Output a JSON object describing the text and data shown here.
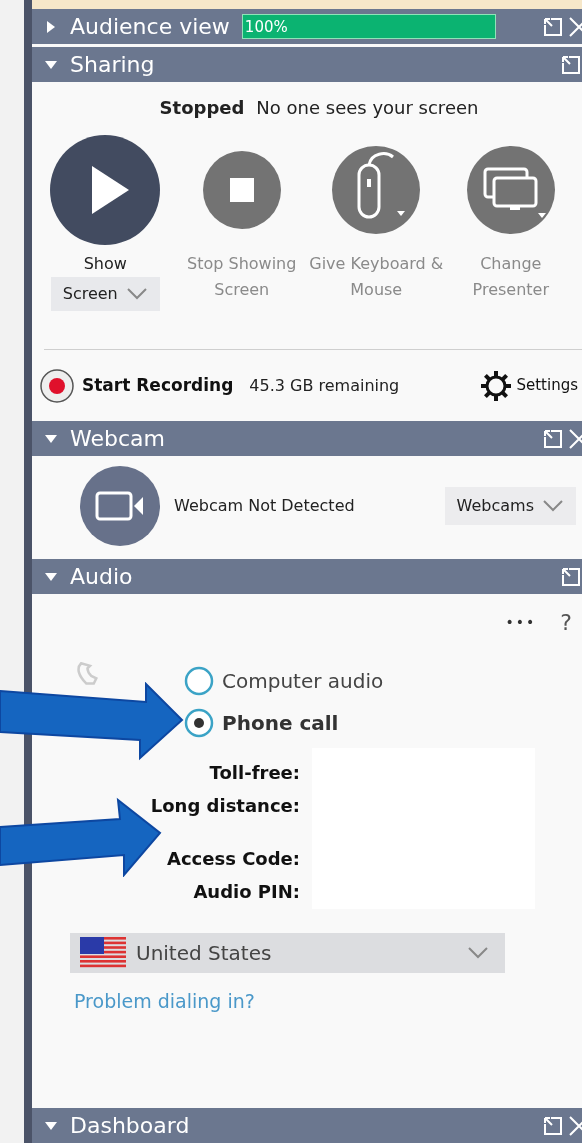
{
  "audience_view": {
    "title": "Audience view",
    "expanded": false,
    "close": true,
    "level": 1,
    "reading": "100%"
  },
  "sharing": {
    "title": "Sharing",
    "expanded": true,
    "close": false,
    "status": "Stopped",
    "status_text": "No one sees your screen",
    "actions": [
      {
        "kind": "show",
        "label": "Show",
        "dropdown": "Screen",
        "disabled": false
      },
      {
        "kind": "stop",
        "label": "Stop Showing Screen",
        "disabled": true
      },
      {
        "kind": "mouse",
        "label": "Give Keyboard & Mouse",
        "disabled": true
      },
      {
        "kind": "presenter",
        "label": "Change Presenter",
        "disabled": true
      }
    ],
    "recording": {
      "label": "Start Recording",
      "remaining": "45.3 GB remaining",
      "settings": "Settings"
    }
  },
  "webcam": {
    "title": "Webcam",
    "expanded": true,
    "close": true,
    "status": "Webcam Not Detected",
    "dropdown": "Webcams"
  },
  "audio": {
    "title": "Audio",
    "expanded": true,
    "close": false,
    "more": "•••",
    "help": "?",
    "options": [
      {
        "label": "Computer audio",
        "selected": false
      },
      {
        "label": "Phone call",
        "selected": true
      }
    ],
    "field_labels": [
      "Toll-free:",
      "Long distance:",
      "Access Code:",
      "Audio PIN:"
    ],
    "country": "United States",
    "problem_link": "Problem dialing in?"
  },
  "dashboard": {
    "title": "Dashboard",
    "expanded": true,
    "close": true
  }
}
